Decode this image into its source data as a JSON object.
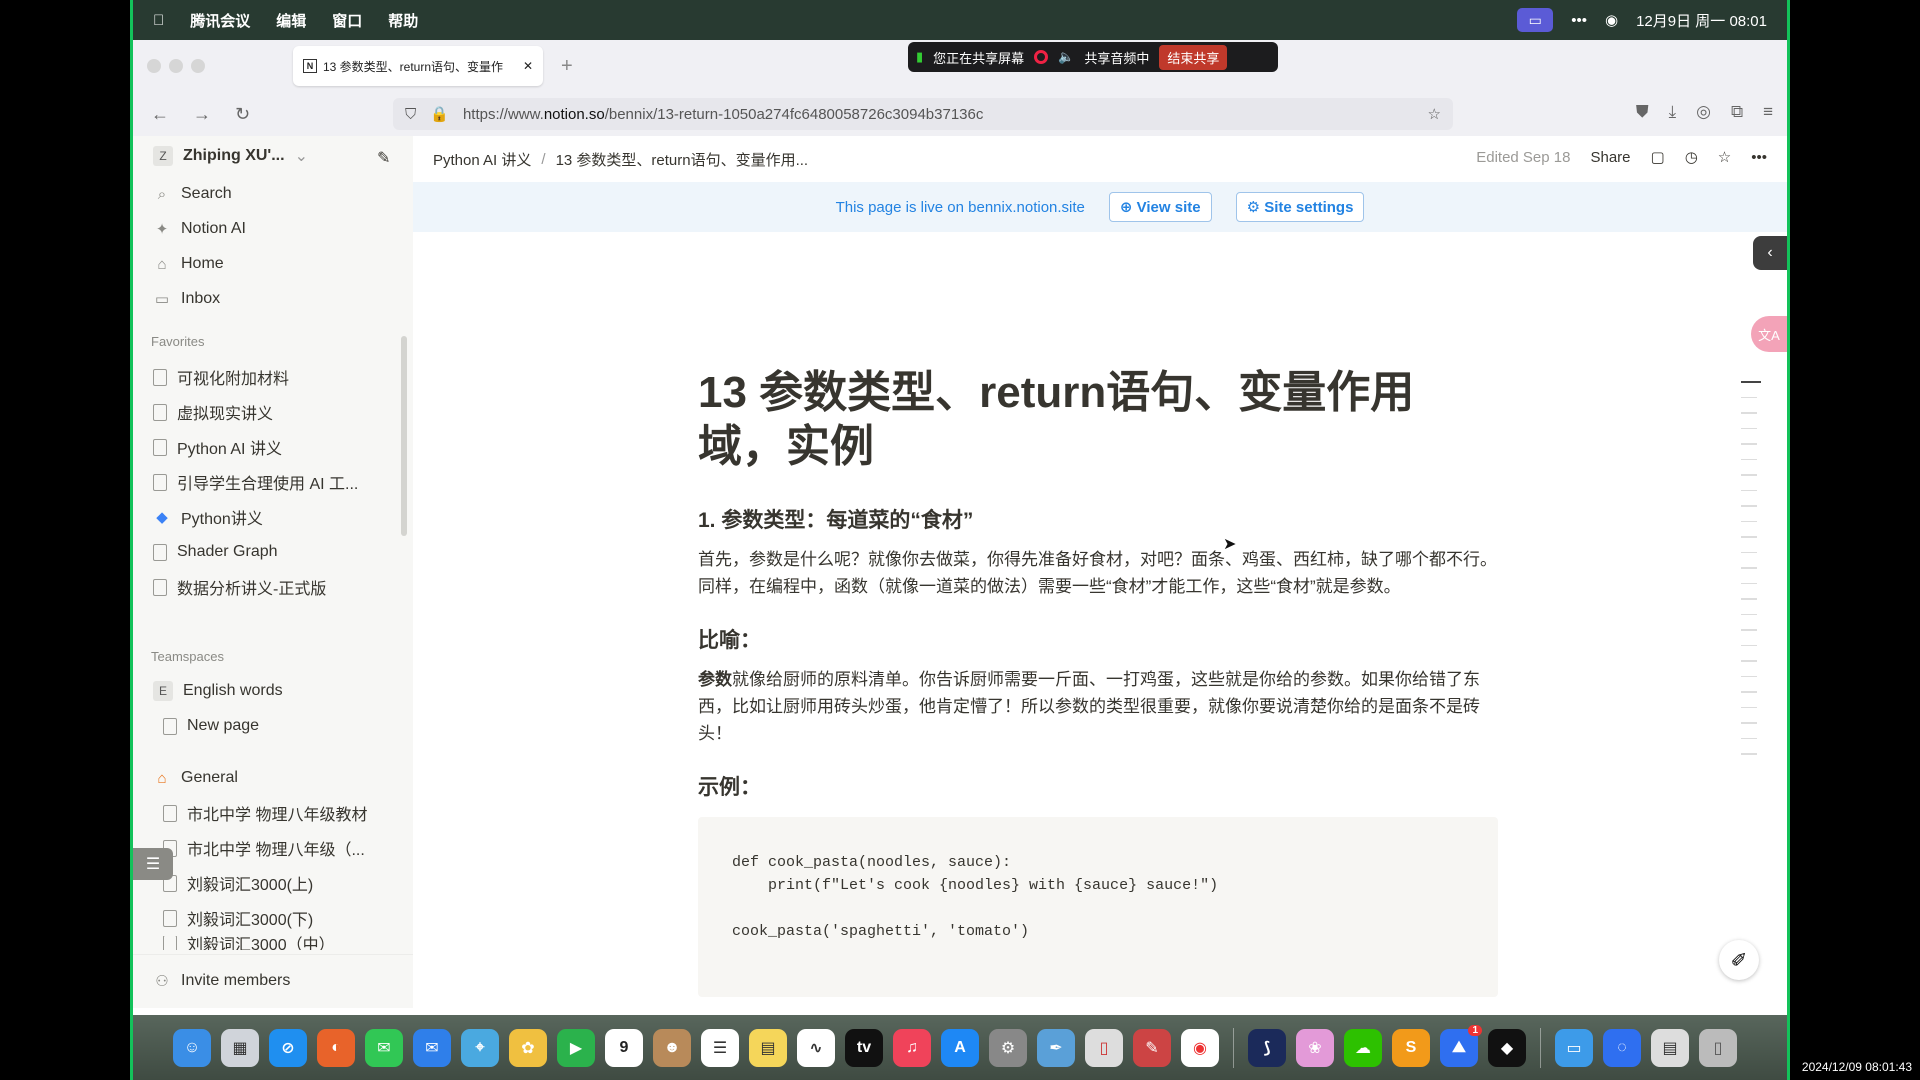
{
  "menubar": {
    "app": "腾讯会议",
    "items": [
      "编辑",
      "窗口",
      "帮助"
    ],
    "datetime": "12月9日 周一 08:01"
  },
  "sharebar": {
    "sharing": "您正在共享屏幕",
    "audio": "共享音频中",
    "end": "结束共享"
  },
  "browser": {
    "tab_title": "13 参数类型、return语句、变量作",
    "url_prefix": "https://www.",
    "url_domain": "notion.so",
    "url_path": "/bennix/13-return-1050a274fc6480058726c3094b37136c"
  },
  "sidebar": {
    "workspace": "Zhiping XU'...",
    "workspace_initial": "Z",
    "nav": [
      "Search",
      "Notion AI",
      "Home",
      "Inbox"
    ],
    "favorites_label": "Favorites",
    "favorites": [
      "可视化附加材料",
      "虚拟现实讲义",
      "Python AI 讲义",
      "引导学生合理使用 AI 工...",
      "Python讲义",
      "Shader Graph",
      "数据分析讲义-正式版"
    ],
    "teamspaces_label": "Teamspaces",
    "team_english": "English words",
    "team_english_initial": "E",
    "new_page": "New page",
    "general": "General",
    "general_items": [
      "市北中学 物理八年级教材",
      "市北中学 物理八年级（...",
      "刘毅词汇3000(上)",
      "刘毅词汇3000(下)",
      "刘毅词汇3000（中）"
    ],
    "invite": "Invite members"
  },
  "topbar": {
    "crumb1": "Python AI 讲义",
    "crumb_sep": "/",
    "crumb2": "13 参数类型、return语句、变量作用...",
    "edited": "Edited Sep 18",
    "share": "Share"
  },
  "banner": {
    "text": "This page is live on bennix.notion.site",
    "view_site": "View site",
    "site_settings": "Site settings"
  },
  "page": {
    "title": "13 参数类型、return语句、变量作用域，实例",
    "h2": "1. 参数类型：每道菜的“食材”",
    "p1": "首先，参数是什么呢？就像你去做菜，你得先准备好食材，对吧？面条、鸡蛋、西红柿，缺了哪个都不行。同样，在编程中，函数（就像一道菜的做法）需要一些“食材”才能工作，这些“食材”就是参数。",
    "h3a": "比喻：",
    "p2_bold": "参数",
    "p2": "就像给厨师的原料清单。你告诉厨师需要一斤面、一打鸡蛋，这些就是你给的参数。如果你给错了东西，比如让厨师用砖头炒蛋，他肯定懵了！所以参数的类型很重要，就像你要说清楚你给的是面条不是砖头！",
    "h3b": "示例：",
    "code": "def cook_pasta(noodles, sauce):\n    print(f\"Let's cook {noodles} with {sauce} sauce!\")\n\ncook_pasta('spaghetti', 'tomato')"
  },
  "dock": {
    "calendar_day": "9",
    "badge": "1"
  },
  "timestamp": "2024/12/09 08:01:43",
  "colors": {
    "accent": "#2383e2",
    "frame_green": "#13c25a",
    "end_share": "#c0392b"
  }
}
